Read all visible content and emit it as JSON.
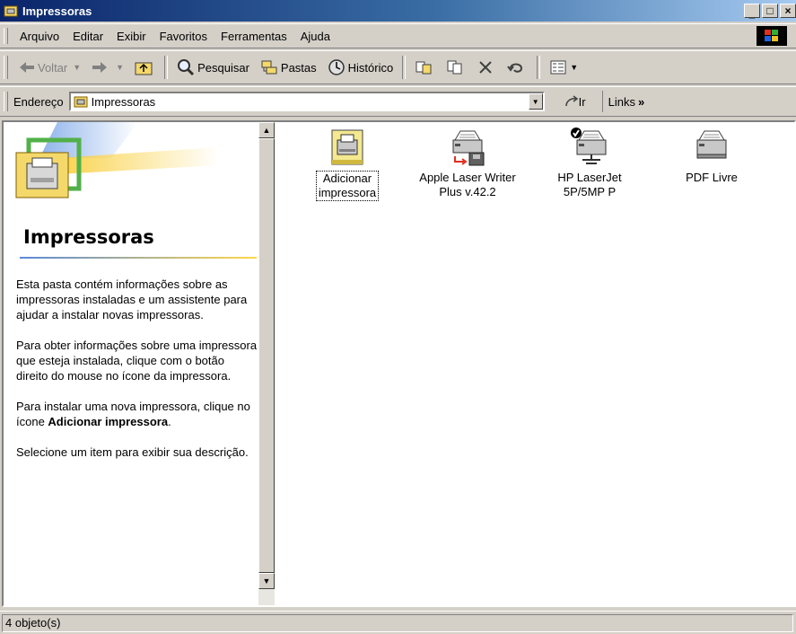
{
  "window": {
    "title": "Impressoras"
  },
  "menu": [
    {
      "label": "Arquivo"
    },
    {
      "label": "Editar"
    },
    {
      "label": "Exibir"
    },
    {
      "label": "Favoritos"
    },
    {
      "label": "Ferramentas"
    },
    {
      "label": "Ajuda"
    }
  ],
  "toolbar": {
    "back": "Voltar",
    "search": "Pesquisar",
    "folders": "Pastas",
    "history": "Histórico"
  },
  "address": {
    "label": "Endereço",
    "value": "Impressoras",
    "go": "Ir",
    "links": "Links"
  },
  "left_pane": {
    "title": "Impressoras",
    "p1": "Esta pasta contém informações sobre as impressoras instaladas e um assistente para ajudar a instalar novas impressoras.",
    "p2": "Para obter informações sobre uma impressora que esteja instalada, clique com o botão direito do mouse no ícone da impressora.",
    "p3_pre": "Para instalar uma nova impressora, clique no ícone ",
    "p3_bold": "Adicionar impressora",
    "p3_post": ".",
    "p4": "Selecione um item para exibir sua descrição."
  },
  "icons": [
    {
      "line1": "Adicionar",
      "line2": "impressora",
      "icon": "add-printer-icon"
    },
    {
      "line1": "Apple Laser Writer",
      "line2": "Plus v.42.2",
      "icon": "network-printer-icon"
    },
    {
      "line1": "HP LaserJet",
      "line2": "5P/5MP P",
      "icon": "default-printer-icon"
    },
    {
      "line1": "PDF Livre",
      "line2": "",
      "icon": "printer-icon"
    }
  ],
  "status": {
    "text": "4 objeto(s)"
  }
}
